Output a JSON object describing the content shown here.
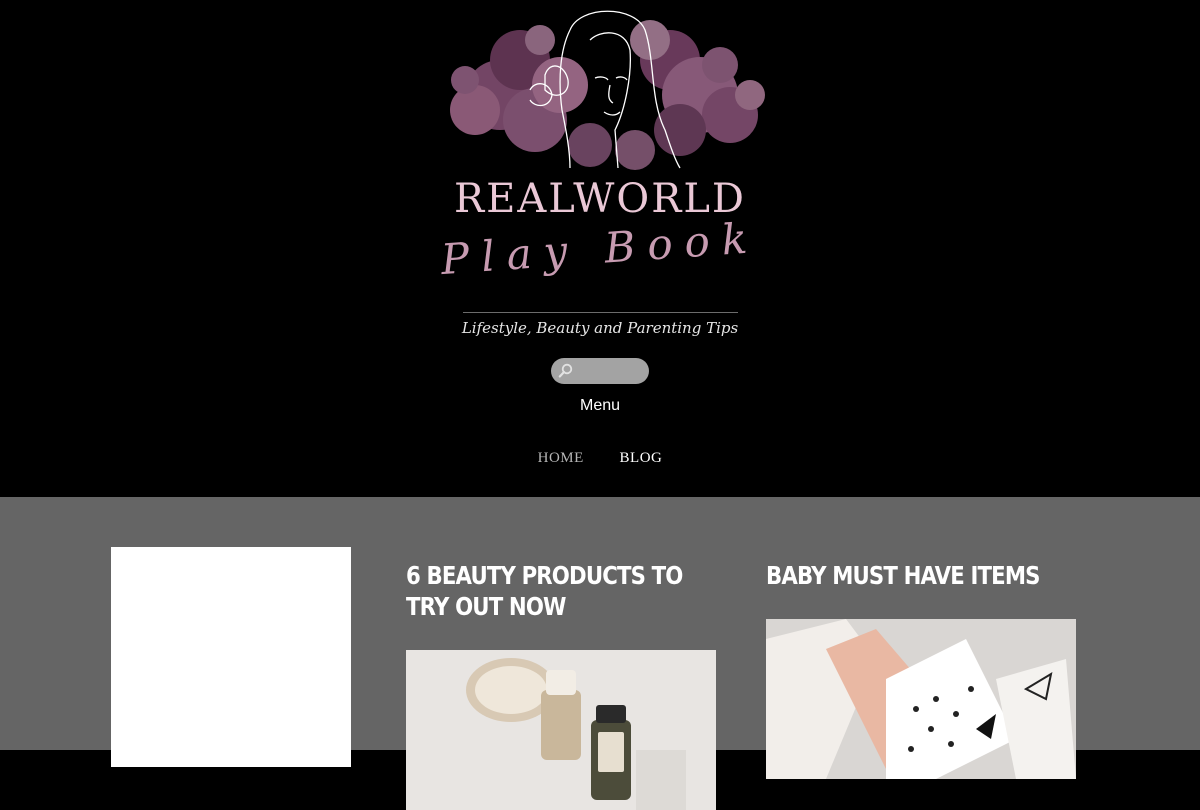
{
  "site": {
    "brand_name": "REALWORLD",
    "brand_script": "Play Book",
    "tagline": "Lifestyle, Beauty and Parenting Tips"
  },
  "search": {
    "placeholder": "",
    "icon": "search-icon"
  },
  "menu_toggle_label": "Menu",
  "nav": {
    "items": [
      {
        "label": "HOME"
      },
      {
        "label": "BLOG"
      }
    ]
  },
  "posts": [
    {
      "title": "6 BEAUTY PRODUCTS TO TRY OUT NOW"
    },
    {
      "title": "BABY MUST HAVE ITEMS"
    }
  ],
  "colors": {
    "header_bg": "#000000",
    "content_bg": "#656565",
    "brand_pink": "#eac8d6",
    "script_pink": "#c79bb1",
    "search_bg": "#a3a3a3"
  }
}
